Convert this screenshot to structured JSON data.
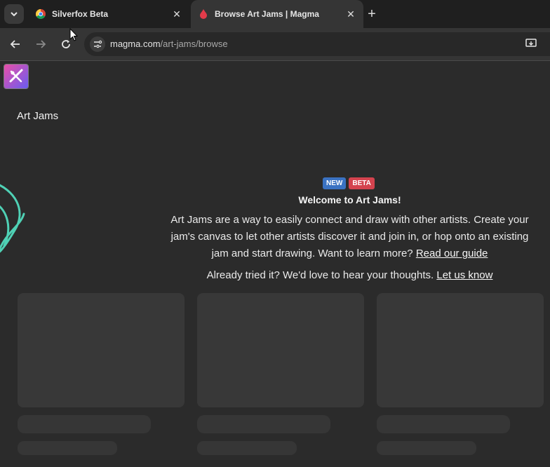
{
  "browser": {
    "tabs": [
      {
        "title": "Silverfox Beta",
        "favicon": "chrome-icon",
        "active": false
      },
      {
        "title": "Browse Art Jams | Magma",
        "favicon": "magma-drop-icon",
        "active": true
      }
    ],
    "url": {
      "host": "magma.com",
      "path": "/art-jams/browse"
    }
  },
  "page": {
    "heading": "Art Jams",
    "badges": {
      "new": "NEW",
      "beta": "BETA"
    },
    "welcome_title": "Welcome to Art Jams!",
    "description": "Art Jams are a way to easily connect and draw with other artists. Create your jam's canvas to let other artists discover it and join in, or hop onto an existing jam and start drawing. Want to learn more?",
    "guide_link": "Read our guide",
    "feedback_text": "Already tried it? We'd love to hear your thoughts.",
    "feedback_link": "Let us know"
  },
  "colors": {
    "badge_new": "#3a72c2",
    "badge_beta": "#d4434e",
    "swirl": "#4fd1b5",
    "logo_gradient": [
      "#e94fa8",
      "#6a5cf0"
    ]
  }
}
